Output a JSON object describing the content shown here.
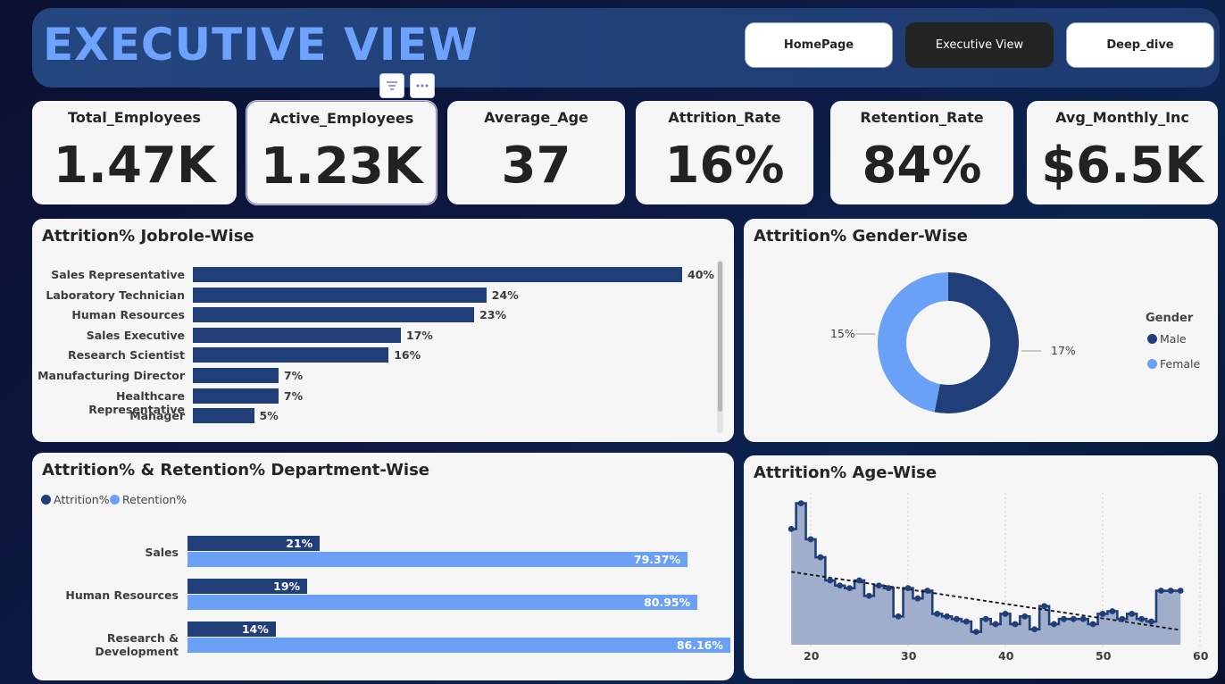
{
  "header": {
    "title": "EXECUTIVE VIEW",
    "nav": [
      {
        "label": "HomePage",
        "active": false
      },
      {
        "label": "Executive View",
        "active": true
      },
      {
        "label": "Deep_dive",
        "active": false
      }
    ],
    "toolbar_icons": [
      "filter-icon",
      "more-options-icon"
    ]
  },
  "kpis": [
    {
      "label": "Total_Employees",
      "value": "1.47K"
    },
    {
      "label": "Active_Employees",
      "value": "1.23K"
    },
    {
      "label": "Average_Age",
      "value": "37"
    },
    {
      "label": "Attrition_Rate",
      "value": "16%"
    },
    {
      "label": "Retention_Rate",
      "value": "84%"
    },
    {
      "label": "Avg_Monthly_Inc",
      "value": "$6.5K"
    }
  ],
  "panels": {
    "jobrole_title": "Attrition% Jobrole-Wise",
    "gender_title": "Attrition% Gender-Wise",
    "department_title": "Attrition% & Retention% Department-Wise",
    "age_title": "Attrition% Age-Wise"
  },
  "colors": {
    "primary": "#203f79",
    "secondary": "#6aa0f6",
    "title_accent": "#6ea2ff"
  },
  "chart_data": [
    {
      "type": "bar",
      "orientation": "horizontal",
      "title": "Attrition% Jobrole-Wise",
      "categories": [
        "Sales Representative",
        "Laboratory Technician",
        "Human Resources",
        "Sales Executive",
        "Research Scientist",
        "Manufacturing Director",
        "Healthcare Representative",
        "Manager"
      ],
      "values": [
        40,
        24,
        23,
        17,
        16,
        7,
        7,
        5
      ],
      "data_labels": [
        "40%",
        "24%",
        "23%",
        "17%",
        "16%",
        "7%",
        "7%",
        "5%"
      ],
      "xlim": [
        0,
        40
      ]
    },
    {
      "type": "pie",
      "variant": "donut",
      "title": "Attrition% Gender-Wise",
      "legend_title": "Gender",
      "legend_position": "right",
      "categories": [
        "Male",
        "Female"
      ],
      "values": [
        17,
        15
      ],
      "data_labels": [
        "17%",
        "15%"
      ]
    },
    {
      "type": "bar",
      "orientation": "horizontal",
      "title": "Attrition% & Retention% Department-Wise",
      "categories": [
        "Sales",
        "Human Resources",
        "Research & Development"
      ],
      "legend_position": "top-left",
      "series": [
        {
          "name": "Attrition%",
          "values": [
            21,
            19,
            14
          ],
          "data_labels": [
            "21%",
            "19%",
            "14%"
          ]
        },
        {
          "name": "Retention%",
          "values": [
            79.37,
            80.95,
            86.16
          ],
          "data_labels": [
            "79.37%",
            "80.95%",
            "86.16%"
          ]
        }
      ],
      "xlim": [
        0,
        90
      ]
    },
    {
      "type": "area",
      "step": true,
      "title": "Attrition% Age-Wise",
      "x_ticks": [
        "20",
        "30",
        "40",
        "50",
        "60"
      ],
      "xlim": [
        17,
        60
      ],
      "ylim": [
        0,
        58
      ],
      "trendline": "linear",
      "x": [
        18,
        19,
        20,
        21,
        22,
        23,
        24,
        25,
        26,
        27,
        28,
        29,
        30,
        31,
        32,
        33,
        34,
        35,
        36,
        37,
        38,
        39,
        40,
        41,
        42,
        43,
        44,
        45,
        46,
        47,
        48,
        49,
        50,
        51,
        52,
        53,
        54,
        55,
        56,
        57,
        58
      ],
      "y": [
        45,
        55,
        41,
        34,
        25,
        23,
        22,
        25,
        19,
        23,
        22,
        11,
        22,
        18,
        21,
        12,
        11,
        10,
        9,
        5,
        10,
        8,
        12,
        8,
        11,
        6,
        15,
        8,
        10,
        10,
        10,
        8,
        12,
        13,
        10,
        12,
        10,
        9,
        21,
        21,
        21
      ]
    }
  ]
}
